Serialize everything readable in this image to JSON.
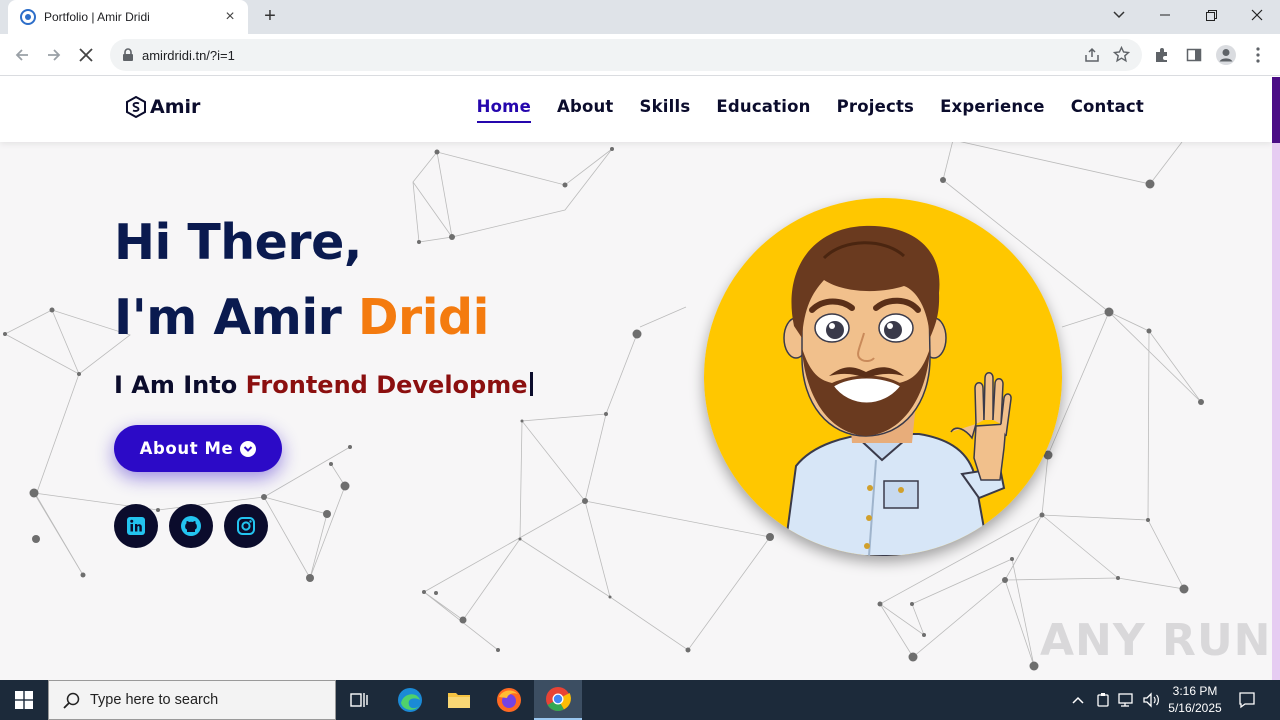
{
  "browser": {
    "tab_title": "Portfolio | Amir Dridi",
    "url": "amirdridi.tn/?i=1"
  },
  "site": {
    "logo_text": "Amir",
    "nav": [
      "Home",
      "About",
      "Skills",
      "Education",
      "Projects",
      "Experience",
      "Contact"
    ],
    "active_nav": "Home",
    "hero": {
      "greeting": "Hi There,",
      "intro": "I'm Amir ",
      "name_accent": "Dridi",
      "typed_prefix": "I Am Into ",
      "typed_role": "Frontend Developme",
      "button_label": "About Me"
    },
    "social": [
      "linkedin-icon",
      "github-icon",
      "instagram-icon"
    ],
    "colors": {
      "navy": "#0a1a4f",
      "accent_orange": "#f47b0f",
      "role_red": "#8b0f0f",
      "button": "#2c0ac7",
      "social_icon": "#23c4f0",
      "avatar_bg": "#ffc700"
    }
  },
  "watermark": "ANY RUN",
  "taskbar": {
    "search_placeholder": "Type here to search",
    "time": "3:16 PM",
    "date": "5/16/2025"
  }
}
